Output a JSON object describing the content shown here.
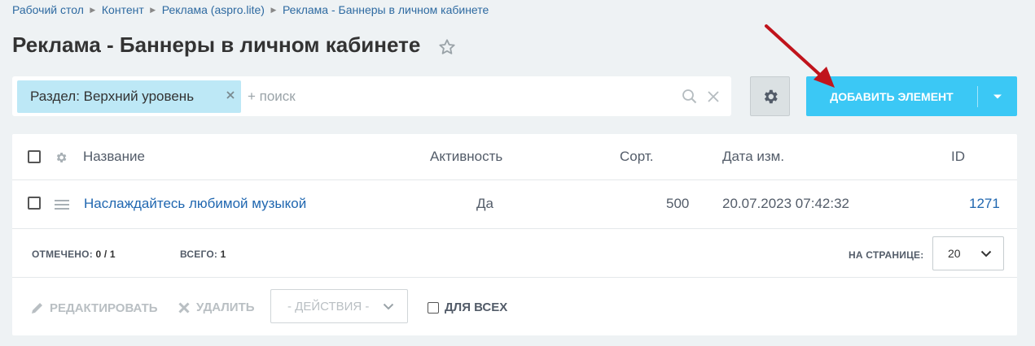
{
  "breadcrumbs": [
    "Рабочий стол",
    "Контент",
    "Реклама (aspro.lite)",
    "Реклама - Баннеры в личном кабинете"
  ],
  "page_title": "Реклама - Баннеры в личном кабинете",
  "filter": {
    "tag_label": "Раздел: Верхний уровень",
    "search_placeholder": "+ поиск"
  },
  "toolbar": {
    "add_label": "ДОБАВИТЬ ЭЛЕМЕНТ"
  },
  "grid": {
    "columns": {
      "name": "Название",
      "active": "Активность",
      "sort": "Сорт.",
      "date": "Дата изм.",
      "id": "ID"
    },
    "rows": [
      {
        "name": "Наслаждайтесь любимой музыкой",
        "active": "Да",
        "sort": "500",
        "date": "20.07.2023 07:42:32",
        "id": "1271"
      }
    ]
  },
  "footer": {
    "checked_label": "ОТМЕЧЕНО:",
    "checked_value": "0 / 1",
    "total_label": "ВСЕГО:",
    "total_value": "1",
    "per_page_label": "НА СТРАНИЦЕ:",
    "per_page_value": "20"
  },
  "actions": {
    "edit_label": "РЕДАКТИРОВАТЬ",
    "delete_label": "УДАЛИТЬ",
    "actions_select": "- ДЕЙСТВИЯ -",
    "for_all_label": "ДЛЯ ВСЕХ"
  },
  "colors": {
    "accent": "#3bc8f5",
    "tag_bg": "#bde8f6",
    "link": "#2067b0",
    "arrow": "#c0141c"
  },
  "icons": [
    "chevron-right-icon",
    "star-icon",
    "close-icon",
    "search-icon",
    "gear-icon",
    "chevron-down-icon",
    "drag-handle-icon",
    "pencil-icon",
    "cross-icon",
    "arrow-annotation"
  ]
}
